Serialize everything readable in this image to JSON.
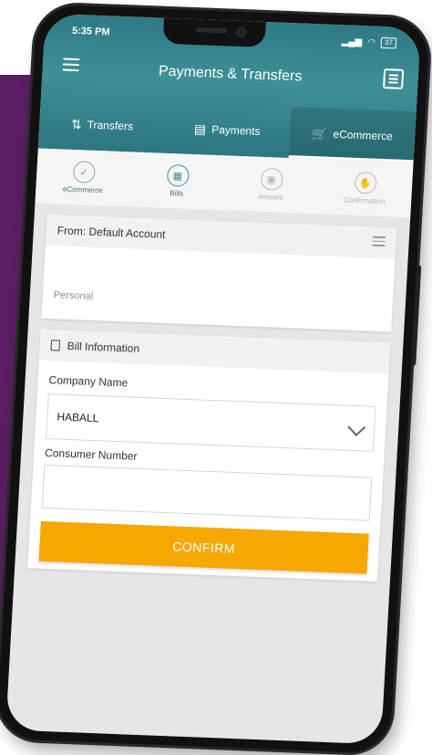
{
  "status_bar": {
    "time": "5:35 PM",
    "battery": "37"
  },
  "header": {
    "title": "Payments & Transfers"
  },
  "tabs": [
    {
      "label": "Transfers",
      "icon": "transfer-arrows-icon",
      "active": false
    },
    {
      "label": "Payments",
      "icon": "receipt-icon",
      "active": false
    },
    {
      "label": "eCommerce",
      "icon": "cart-icon",
      "active": true
    }
  ],
  "steps": [
    {
      "label": "eCommerce",
      "icon": "check-icon",
      "state": "done"
    },
    {
      "label": "Bills",
      "icon": "bill-icon",
      "state": "current"
    },
    {
      "label": "Amount",
      "icon": "calculator-icon",
      "state": "pending"
    },
    {
      "label": "Confirmation",
      "icon": "handshake-icon",
      "state": "pending"
    }
  ],
  "from_account": {
    "title": "From: Default Account",
    "value": "Personal"
  },
  "bill_info": {
    "title": "Bill Information",
    "company_label": "Company Name",
    "company_value": "HABALL",
    "consumer_label": "Consumer Number",
    "consumer_value": ""
  },
  "confirm_label": "CONFIRM",
  "colors": {
    "header": "#3f8f96",
    "accent": "#f5a800",
    "purple": "#5b1e63"
  }
}
